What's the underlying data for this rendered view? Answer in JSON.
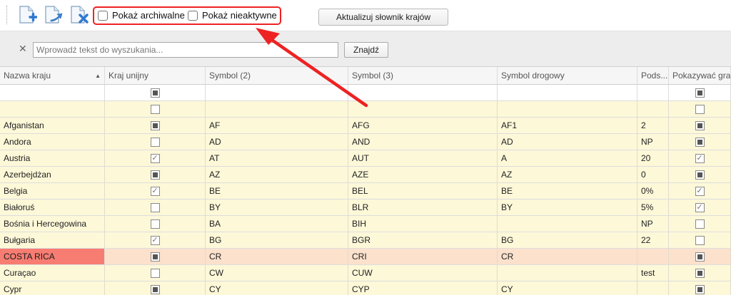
{
  "toolbar": {
    "buttons": [
      {
        "name": "add-document-icon",
        "color": "#3a7fd5"
      },
      {
        "name": "edit-document-icon",
        "color": "#3a7fd5"
      },
      {
        "name": "delete-document-icon",
        "color": "#3a7fd5"
      }
    ],
    "show_archived_label": "Pokaż archiwalne",
    "show_inactive_label": "Pokaż nieaktywne",
    "update_button_label": "Aktualizuj słownik krajów",
    "highlight_color": "#ee2222"
  },
  "search": {
    "placeholder": "Wprowadź tekst do wyszukania...",
    "value": "",
    "find_label": "Znajdź"
  },
  "grid": {
    "columns": [
      "Nazwa kraju",
      "Kraj unijny",
      "Symbol (2)",
      "Symbol (3)",
      "Symbol drogowy",
      "Pods...",
      "Pokazywać gran"
    ],
    "sort_column": "Nazwa kraju",
    "sort_direction": "ascending",
    "filter_row": {
      "kraj_unijny": "indeterminate",
      "pokazywac": "indeterminate"
    },
    "rows": [
      {
        "name": "",
        "eu": "unchecked",
        "s2": "",
        "s3": "",
        "road": "",
        "pods": "",
        "show": "unchecked"
      },
      {
        "name": "Afganistan",
        "eu": "indeterminate",
        "s2": "AF",
        "s3": "AFG",
        "road": "AF1",
        "pods": "2",
        "show": "indeterminate"
      },
      {
        "name": "Andora",
        "eu": "unchecked",
        "s2": "AD",
        "s3": "AND",
        "road": "AD",
        "pods": "NP",
        "show": "indeterminate"
      },
      {
        "name": "Austria",
        "eu": "checked",
        "s2": "AT",
        "s3": "AUT",
        "road": "A",
        "pods": "20",
        "show": "checked"
      },
      {
        "name": "Azerbejdżan",
        "eu": "indeterminate",
        "s2": "AZ",
        "s3": "AZE",
        "road": "AZ",
        "pods": "0",
        "show": "indeterminate"
      },
      {
        "name": "Belgia",
        "eu": "checked",
        "s2": "BE",
        "s3": "BEL",
        "road": "BE",
        "pods": "0%",
        "show": "checked"
      },
      {
        "name": "Białoruś",
        "eu": "unchecked",
        "s2": "BY",
        "s3": "BLR",
        "road": "BY",
        "pods": "5%",
        "show": "checked"
      },
      {
        "name": "Bośnia i Hercegowina",
        "eu": "unchecked",
        "s2": "BA",
        "s3": "BIH",
        "road": "",
        "pods": "NP",
        "show": "unchecked"
      },
      {
        "name": "Bułgaria",
        "eu": "checked",
        "s2": "BG",
        "s3": "BGR",
        "road": "BG",
        "pods": "22",
        "show": "unchecked"
      },
      {
        "name": "COSTA RICA",
        "eu": "indeterminate",
        "s2": "CR",
        "s3": "CRI",
        "road": "CR",
        "pods": "",
        "show": "indeterminate",
        "selected": true
      },
      {
        "name": "Curaçao",
        "eu": "unchecked",
        "s2": "CW",
        "s3": "CUW",
        "road": "",
        "pods": "test",
        "show": "indeterminate"
      },
      {
        "name": "Cypr",
        "eu": "indeterminate",
        "s2": "CY",
        "s3": "CYP",
        "road": "CY",
        "pods": "",
        "show": "indeterminate"
      }
    ]
  },
  "colors": {
    "row_bg": "#fdf8d8",
    "selected_row_bg": "#fce1cc",
    "selected_cell_bg": "#f77d73",
    "arrow_color": "#ee2222"
  }
}
